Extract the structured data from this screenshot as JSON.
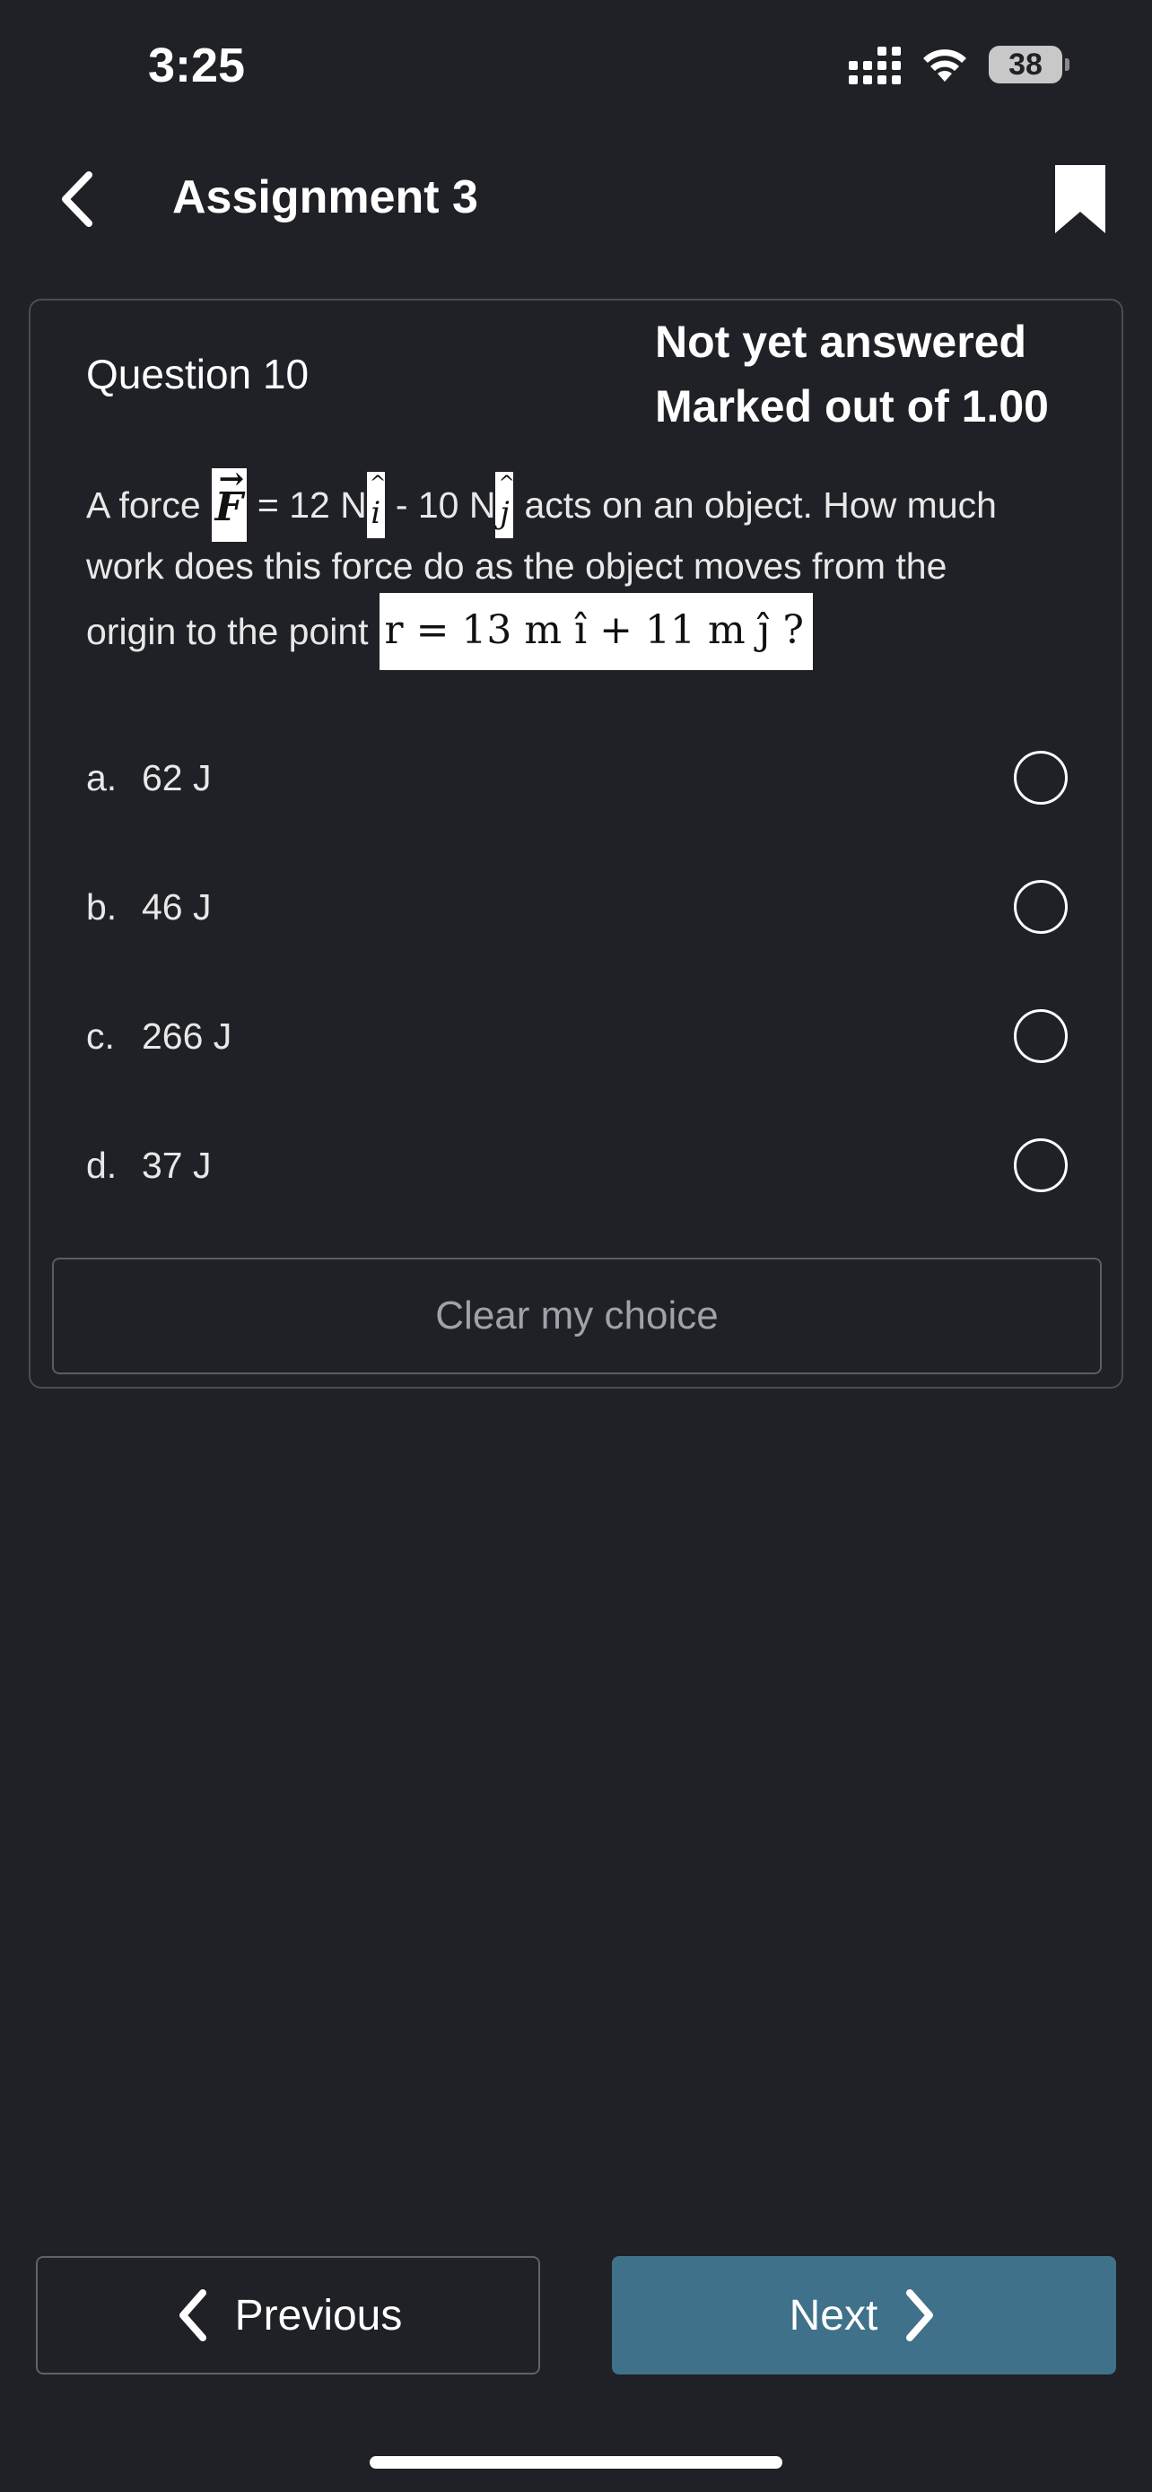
{
  "status_bar": {
    "time": "3:25",
    "battery": "38"
  },
  "header": {
    "title": "Assignment 3",
    "back_icon": "chevron-left-icon",
    "bookmark_icon": "bookmark-icon"
  },
  "question": {
    "number": "Question 10",
    "status": "Not yet answered",
    "marks": "Marked out of 1.00",
    "text_prefix": "A force",
    "force_symbol": "F",
    "text_eq": "= 12 N",
    "text_minus": "- 10 N",
    "unit_i": "i",
    "unit_j": "j",
    "text_after_force": "acts on an object. How much",
    "text_line2": "work does this force do as the object moves from the",
    "text_line3": "origin to the point",
    "point_expr": "r = 13 m î + 11 m ĵ ?"
  },
  "answers": [
    {
      "letter": "a.",
      "text": "62 J"
    },
    {
      "letter": "b.",
      "text": "46 J"
    },
    {
      "letter": "c.",
      "text": "266 J"
    },
    {
      "letter": "d.",
      "text": "37 J"
    }
  ],
  "clear_label": "Clear my choice",
  "nav": {
    "previous_label": "Previous",
    "next_label": "Next"
  },
  "colors": {
    "background": "#1f2126",
    "next_button": "#3f718a",
    "border": "#4a4d55"
  }
}
